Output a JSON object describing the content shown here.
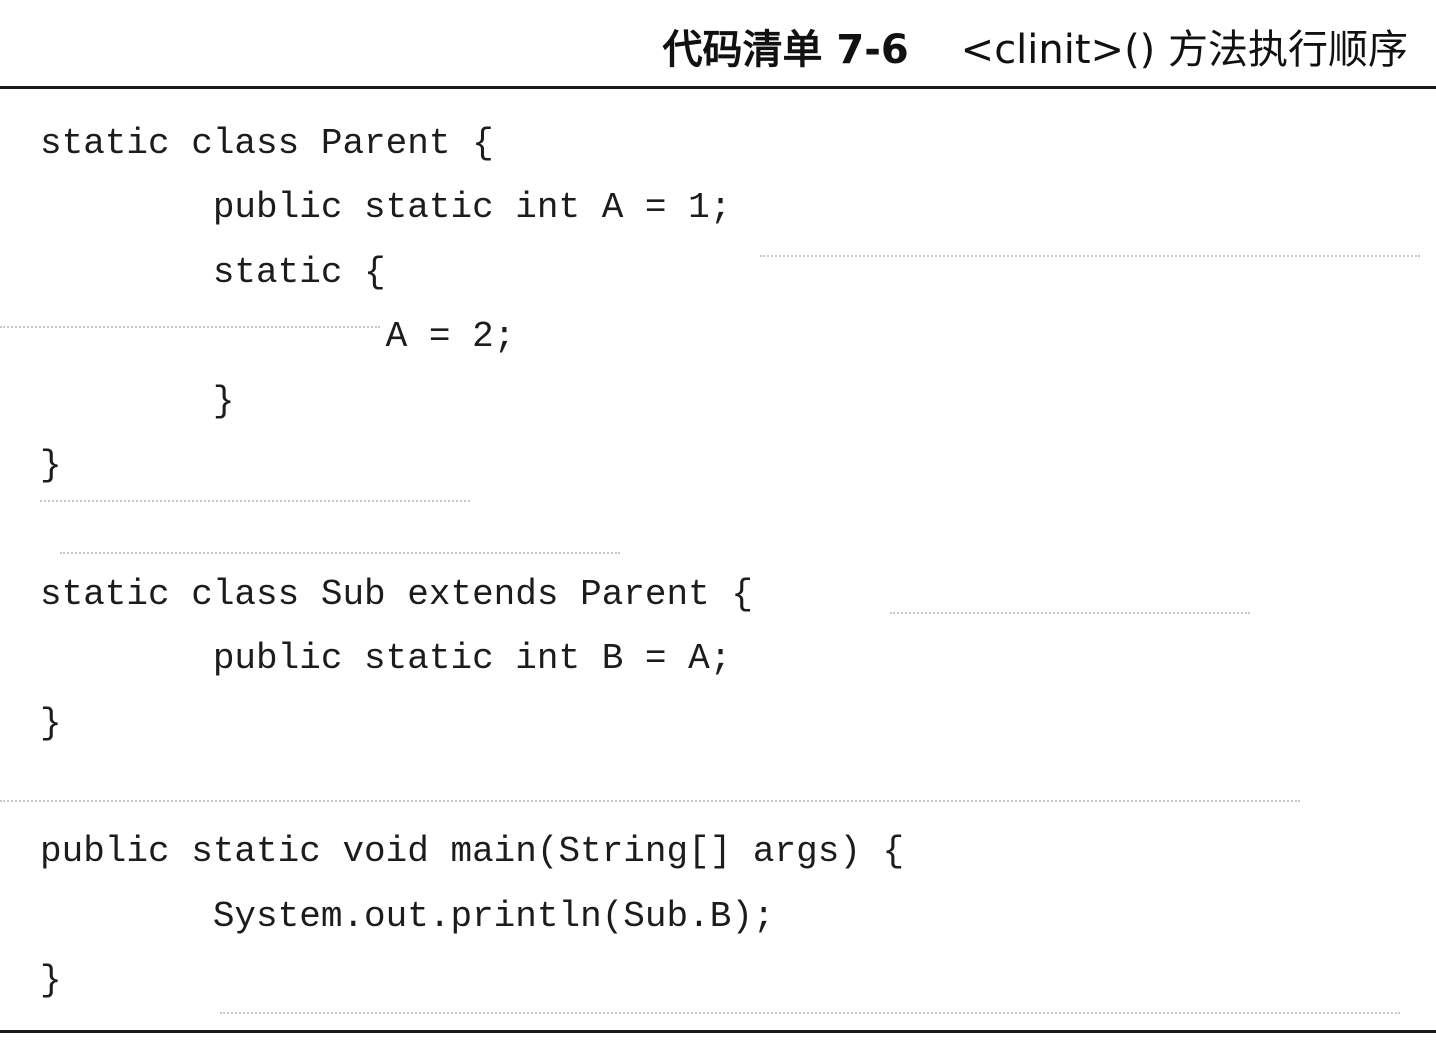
{
  "listing": {
    "label": "代码清单 7-6",
    "title": "<clinit>() 方法执行顺序"
  },
  "code_lines": [
    "static class Parent {",
    "        public static int A = 1;",
    "        static {",
    "                A = 2;",
    "        }",
    "}",
    "",
    "static class Sub extends Parent {",
    "        public static int B = A;",
    "}",
    "",
    "public static void main(String[] args) {",
    "        System.out.println(Sub.B);",
    "}"
  ]
}
